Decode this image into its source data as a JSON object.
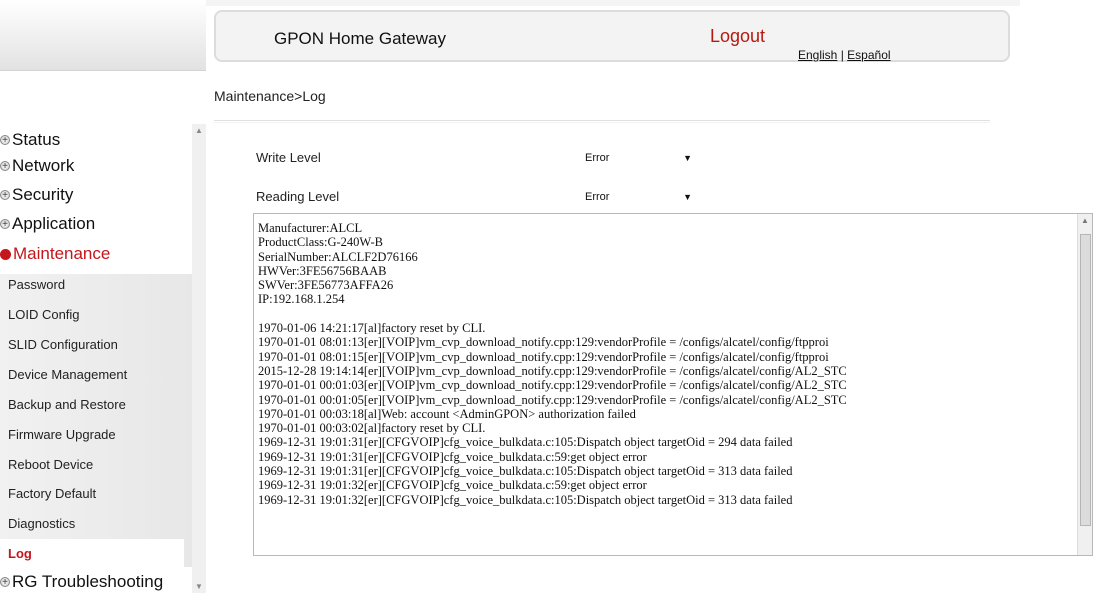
{
  "header": {
    "title": "GPON Home Gateway",
    "logout": "Logout",
    "lang_english": "English",
    "lang_separator": "|",
    "lang_spanish": "Español"
  },
  "breadcrumb": "Maintenance>Log",
  "sidebar": {
    "sections": [
      {
        "label": "Status"
      },
      {
        "label": "Network"
      },
      {
        "label": "Security"
      },
      {
        "label": "Application"
      },
      {
        "label": "Maintenance"
      },
      {
        "label": "RG Troubleshooting"
      }
    ],
    "items": [
      {
        "label": "Password"
      },
      {
        "label": "LOID Config"
      },
      {
        "label": "SLID Configuration"
      },
      {
        "label": "Device Management"
      },
      {
        "label": "Backup and Restore"
      },
      {
        "label": "Firmware Upgrade"
      },
      {
        "label": "Reboot Device"
      },
      {
        "label": "Factory Default"
      },
      {
        "label": "Diagnostics"
      },
      {
        "label": "Log"
      }
    ]
  },
  "form": {
    "write_level_label": "Write Level",
    "write_level_value": "Error",
    "reading_level_label": "Reading Level",
    "reading_level_value": "Error"
  },
  "log_text": "Manufacturer:ALCL\nProductClass:G-240W-B\nSerialNumber:ALCLF2D76166\nHWVer:3FE56756BAAB\nSWVer:3FE56773AFFA26\nIP:192.168.1.254\n\n1970-01-06 14:21:17[al]factory reset by CLI.\n1970-01-01 08:01:13[er][VOIP]vm_cvp_download_notify.cpp:129:vendorProfile = /configs/alcatel/config/ftpproi\n1970-01-01 08:01:15[er][VOIP]vm_cvp_download_notify.cpp:129:vendorProfile = /configs/alcatel/config/ftpproi\n2015-12-28 19:14:14[er][VOIP]vm_cvp_download_notify.cpp:129:vendorProfile = /configs/alcatel/config/AL2_STC\n1970-01-01 00:01:03[er][VOIP]vm_cvp_download_notify.cpp:129:vendorProfile = /configs/alcatel/config/AL2_STC\n1970-01-01 00:01:05[er][VOIP]vm_cvp_download_notify.cpp:129:vendorProfile = /configs/alcatel/config/AL2_STC\n1970-01-01 00:03:18[al]Web: account <AdminGPON> authorization failed\n1970-01-01 00:03:02[al]factory reset by CLI.\n1969-12-31 19:01:31[er][CFGVOIP]cfg_voice_bulkdata.c:105:Dispatch object targetOid = 294 data failed\n1969-12-31 19:01:31[er][CFGVOIP]cfg_voice_bulkdata.c:59:get object error\n1969-12-31 19:01:31[er][CFGVOIP]cfg_voice_bulkdata.c:105:Dispatch object targetOid = 313 data failed\n1969-12-31 19:01:32[er][CFGVOIP]cfg_voice_bulkdata.c:59:get object error\n1969-12-31 19:01:32[er][CFGVOIP]cfg_voice_bulkdata.c:105:Dispatch object targetOid = 313 data failed",
  "colors": {
    "accent_red": "#c4161c",
    "logout_red": "#b51a10"
  }
}
